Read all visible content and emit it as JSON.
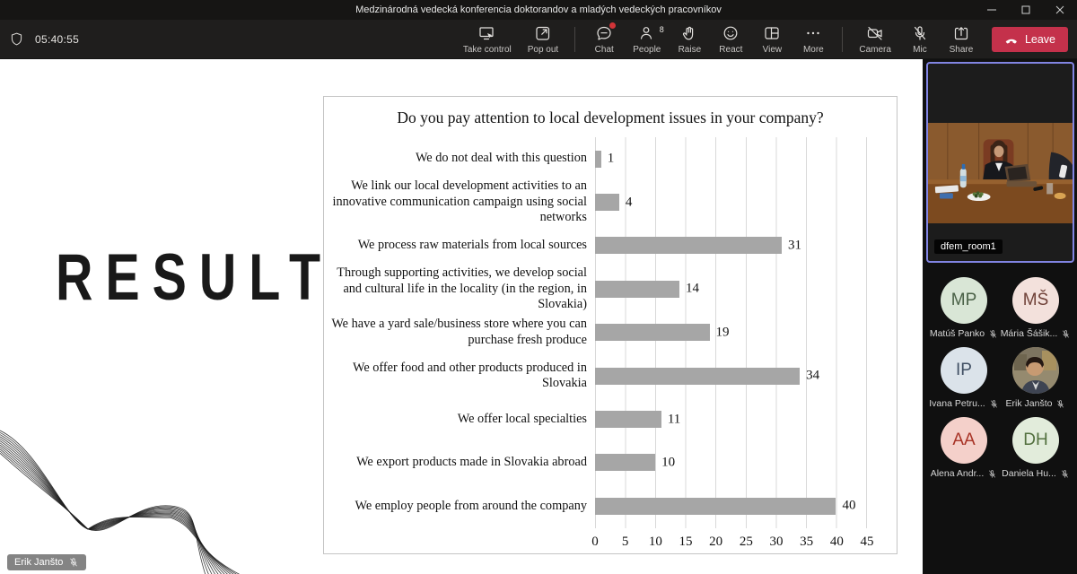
{
  "titlebar": {
    "title": "Medzinárodná vedecká konferencia doktorandov a mladých vedeckých pracovníkov"
  },
  "toolbar": {
    "timer": "05:40:55",
    "take_control": "Take control",
    "pop_out": "Pop out",
    "chat": "Chat",
    "people": "People",
    "people_count": "8",
    "raise": "Raise",
    "react": "React",
    "view": "View",
    "more": "More",
    "camera": "Camera",
    "mic": "Mic",
    "share": "Share",
    "leave": "Leave"
  },
  "slide": {
    "results_title": "RESULTS",
    "presenter_badge": "Erik Janšto"
  },
  "chart_data": {
    "type": "bar",
    "orientation": "horizontal",
    "title": "Do you pay attention to local development issues in your company?",
    "categories": [
      "We do not deal with this question",
      "We link our local development activities to an innovative communication campaign using social networks",
      "We process raw materials from local sources",
      "Through supporting activities, we develop social and cultural life in the locality (in the region, in Slovakia)",
      "We have a yard sale/business store where you can purchase fresh produce",
      "We offer food and other products produced in Slovakia",
      "We offer local specialties",
      "We export products made in Slovakia abroad",
      "We employ people from around the company"
    ],
    "values": [
      1,
      4,
      31,
      14,
      19,
      34,
      11,
      10,
      40
    ],
    "xlim": [
      0,
      45
    ],
    "xticks": [
      0,
      5,
      10,
      15,
      20,
      25,
      30,
      35,
      40,
      45
    ],
    "bar_color": "#a6a6a6",
    "grid": true,
    "legend_position": "none"
  },
  "sidebar": {
    "video_tile": {
      "label": "dfem_room1",
      "border_color": "#8184e2"
    },
    "participants": [
      {
        "initials": "MP",
        "name": "Matúš Panko",
        "muted": true,
        "bg": "#d9e6d6",
        "fg": "#4a6147"
      },
      {
        "initials": "MŠ",
        "name": "Mária Šášik...",
        "muted": true,
        "bg": "#f3e1dc",
        "fg": "#6f4138"
      },
      {
        "initials": "IP",
        "name": "Ivana Petru...",
        "muted": true,
        "bg": "#dbe3ea",
        "fg": "#404f63"
      },
      {
        "initials": "",
        "name": "Erik Janšto",
        "muted": true,
        "photo": true
      },
      {
        "initials": "AA",
        "name": "Alena Andr...",
        "muted": true,
        "bg": "#f4d0ca",
        "fg": "#a83326"
      },
      {
        "initials": "DH",
        "name": "Daniela Hu...",
        "muted": true,
        "bg": "#e2ecdb",
        "fg": "#53703f"
      }
    ]
  }
}
